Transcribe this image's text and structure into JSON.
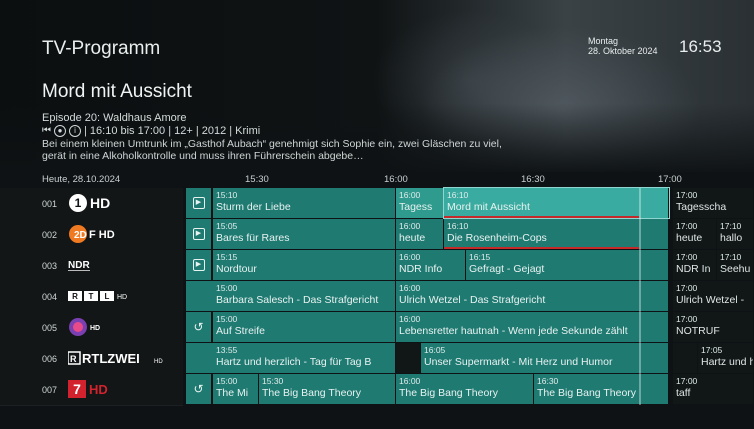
{
  "header": {
    "app_title": "TV-Programm",
    "day": "Montag",
    "date": "28. Oktober 2024",
    "time": "16:53"
  },
  "details": {
    "title": "Mord mit Aussicht",
    "episode": "Episode 20: Waldhaus Amore",
    "meta": "| 16:10 bis 17:00 | 12+ | 2012 | Krimi",
    "description": "Bei einem kleinen Umtrunk im „Gasthof Aubach“ genehmigt sich Sophie ein, zwei Gläschen zu viel, gerät in eine Alkoholkontrolle und muss ihren Führerschein abgebe…",
    "icons": [
      "restart-icon",
      "record-icon",
      "info-icon"
    ]
  },
  "timeline": {
    "date_label": "Heute, 28.10.2024",
    "ticks": [
      "15:30",
      "16:00",
      "16:30",
      "17:00"
    ]
  },
  "channels": [
    {
      "num": "001",
      "logo": "1HD",
      "badge": "play-icon",
      "programs": [
        {
          "time": "15:10",
          "title": "Sturm der Liebe"
        },
        {
          "time": "16:00",
          "title": "Tagess"
        },
        {
          "time": "16:10",
          "title": "Mord mit Aussicht",
          "selected": true
        },
        {
          "time": "17:00",
          "title": "Tagesscha"
        }
      ]
    },
    {
      "num": "002",
      "logo": "ZDF HD",
      "badge": "play-icon",
      "programs": [
        {
          "time": "15:05",
          "title": "Bares für Rares"
        },
        {
          "time": "16:00",
          "title": "heute"
        },
        {
          "time": "16:10",
          "title": "Die Rosenheim-Cops"
        },
        {
          "time": "17:00",
          "title": "heute"
        },
        {
          "time": "17:10",
          "title": "hallo"
        }
      ]
    },
    {
      "num": "003",
      "logo": "NDR",
      "badge": "play-icon",
      "programs": [
        {
          "time": "15:15",
          "title": "Nordtour"
        },
        {
          "time": "16:00",
          "title": "NDR Info"
        },
        {
          "time": "16:15",
          "title": "Gefragt - Gejagt"
        },
        {
          "time": "17:00",
          "title": "NDR In"
        },
        {
          "time": "17:10",
          "title": "Seehu"
        }
      ]
    },
    {
      "num": "004",
      "logo": "RTL HD",
      "badge": "",
      "programs": [
        {
          "time": "15:00",
          "title": "Barbara Salesch - Das Strafgericht"
        },
        {
          "time": "16:00",
          "title": "Ulrich Wetzel - Das Strafgericht"
        },
        {
          "time": "17:00",
          "title": "Ulrich Wetzel -"
        }
      ]
    },
    {
      "num": "005",
      "logo": "Sat.1 HD",
      "badge": "replay-icon",
      "programs": [
        {
          "time": "15:00",
          "title": "Auf Streife"
        },
        {
          "time": "16:00",
          "title": "Lebensretter hautnah - Wenn jede Sekunde zählt"
        },
        {
          "time": "17:00",
          "title": "NOTRUF"
        }
      ]
    },
    {
      "num": "006",
      "logo": "RTLZWEI HD",
      "badge": "",
      "programs": [
        {
          "time": "13:55",
          "title": "Hartz und herzlich - Tag für Tag B"
        },
        {
          "time": "16:05",
          "title": "Unser Supermarkt - Mit Herz und Humor"
        },
        {
          "time": "17:05",
          "title": "Hartz und he"
        }
      ]
    },
    {
      "num": "007",
      "logo": "7 HD",
      "badge": "replay-icon",
      "programs": [
        {
          "time": "15:00",
          "title": "The Mi"
        },
        {
          "time": "15:30",
          "title": "The Big Bang Theory"
        },
        {
          "time": "16:00",
          "title": "The Big Bang Theory"
        },
        {
          "time": "16:30",
          "title": "The Big Bang Theory"
        },
        {
          "time": "17:00",
          "title": "taff"
        }
      ]
    }
  ],
  "colors": {
    "accent": "#1f7a72",
    "selected": "#3aaba0",
    "progress": "#c42a2a"
  }
}
